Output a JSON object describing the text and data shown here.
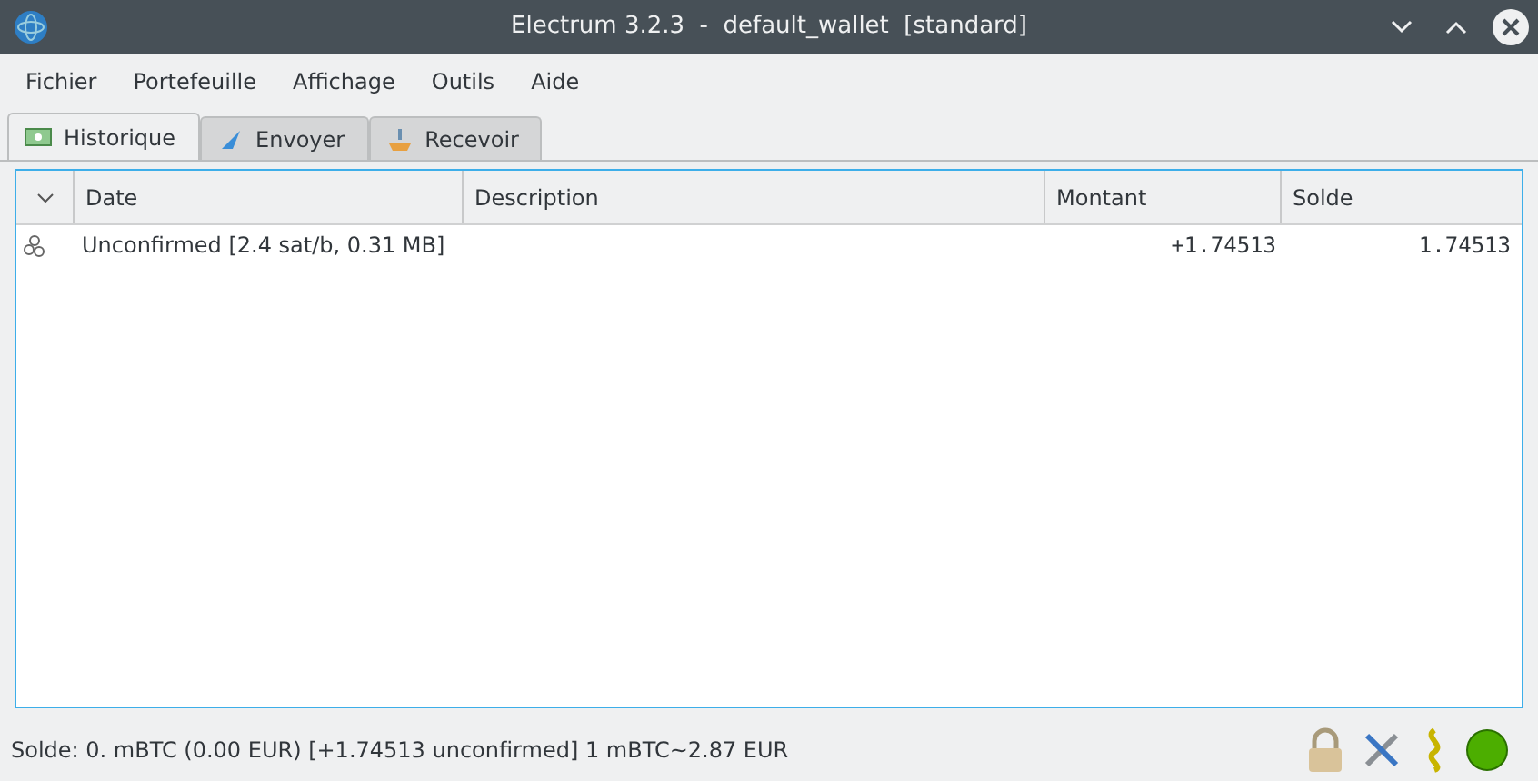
{
  "window": {
    "title": "Electrum 3.2.3  -  default_wallet  [standard]"
  },
  "menu": [
    "Fichier",
    "Portefeuille",
    "Affichage",
    "Outils",
    "Aide"
  ],
  "tabs": [
    {
      "label": "Historique",
      "selected": true,
      "kind": "history"
    },
    {
      "label": "Envoyer",
      "selected": false,
      "kind": "send"
    },
    {
      "label": "Recevoir",
      "selected": false,
      "kind": "receive"
    }
  ],
  "table": {
    "columns": [
      "Date",
      "Description",
      "Montant",
      "Solde"
    ],
    "rows": [
      {
        "date": "Unconfirmed [2.4 sat/b, 0.31 MB]",
        "description": "",
        "amount": "+1.74513",
        "balance": "1.74513"
      }
    ]
  },
  "status_bar": {
    "text": "Solde: 0. mBTC (0.00 EUR)  [+1.74513 unconfirmed] 1 mBTC~2.87 EUR",
    "connected": true
  }
}
